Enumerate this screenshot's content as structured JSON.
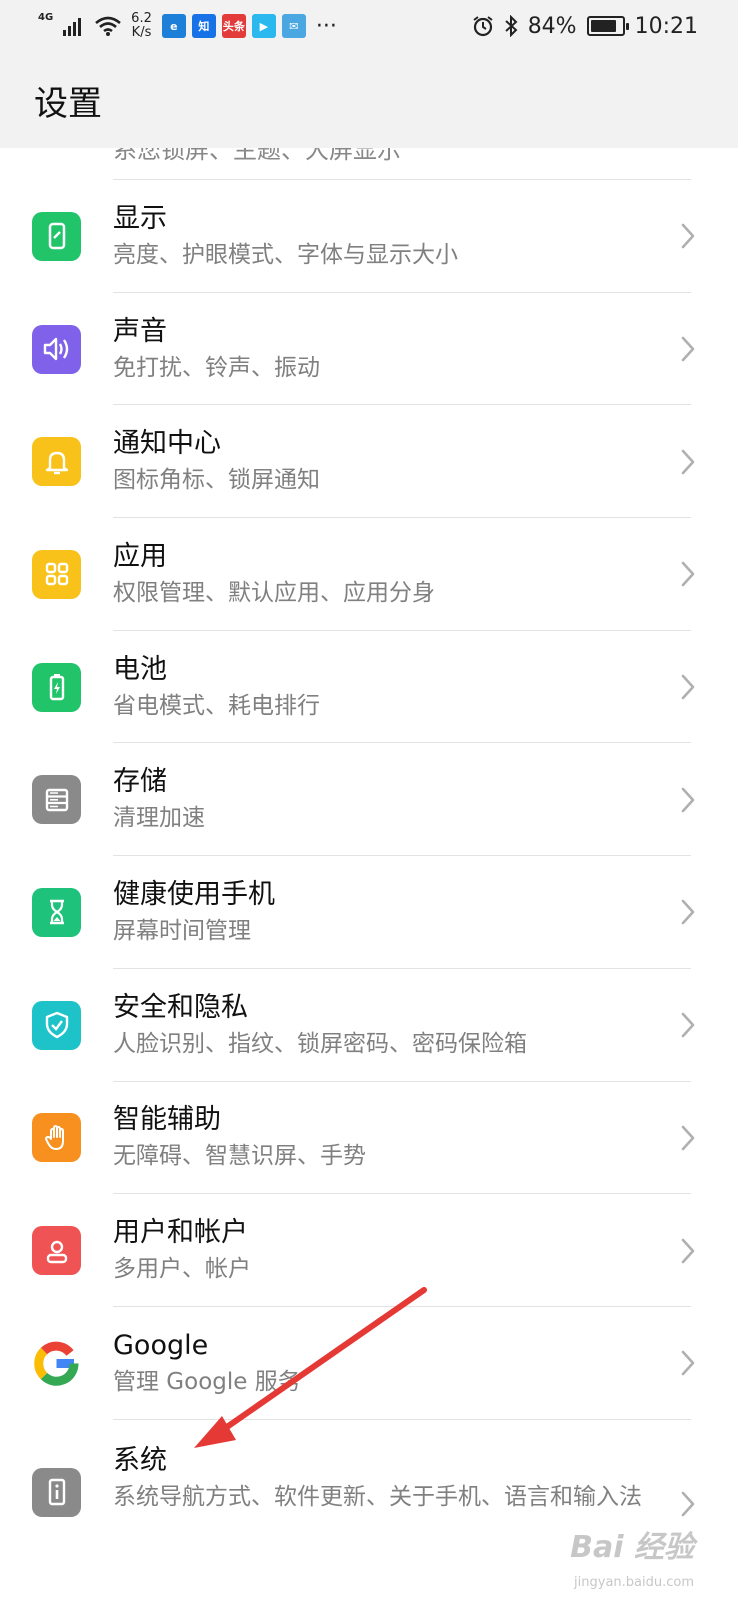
{
  "status_bar": {
    "network": "4G",
    "speed_value": "6.2",
    "speed_unit": "K/s",
    "notification_apps": [
      {
        "icon": "browser-icon",
        "label": "e",
        "color": "#1e7fd8"
      },
      {
        "icon": "zhihu-icon",
        "label": "知",
        "color": "#1772e8"
      },
      {
        "icon": "toutiao-icon",
        "label": "头条",
        "color": "#e33a3a"
      },
      {
        "icon": "video-icon",
        "label": "▶",
        "color": "#2bb8ef"
      },
      {
        "icon": "mail-icon",
        "label": "✉",
        "color": "#4aa7e2"
      }
    ],
    "more": "···",
    "battery_percent": "84%",
    "battery_level": 0.84,
    "time": "10:21"
  },
  "header": {
    "title": "设置"
  },
  "cut_row": {
    "text": "系您锁屏、主题、大屏显示"
  },
  "items": [
    {
      "name": "display",
      "icon": "display-icon",
      "color": "#22c46a",
      "title": "显示",
      "subtitle": "亮度、护眼模式、字体与显示大小"
    },
    {
      "name": "sound",
      "icon": "speaker-icon",
      "color": "#8062ea",
      "title": "声音",
      "subtitle": "免打扰、铃声、振动"
    },
    {
      "name": "notification",
      "icon": "bell-icon",
      "color": "#f8c21b",
      "title": "通知中心",
      "subtitle": "图标角标、锁屏通知"
    },
    {
      "name": "apps",
      "icon": "grid-icon",
      "color": "#f8c21b",
      "title": "应用",
      "subtitle": "权限管理、默认应用、应用分身"
    },
    {
      "name": "battery",
      "icon": "battery-icon",
      "color": "#22c46a",
      "title": "电池",
      "subtitle": "省电模式、耗电排行"
    },
    {
      "name": "storage",
      "icon": "storage-icon",
      "color": "#8a8a8a",
      "title": "存储",
      "subtitle": "清理加速"
    },
    {
      "name": "digital-balance",
      "icon": "hourglass-icon",
      "color": "#1fc27a",
      "title": "健康使用手机",
      "subtitle": "屏幕时间管理"
    },
    {
      "name": "security",
      "icon": "shield-icon",
      "color": "#1ec3c9",
      "title": "安全和隐私",
      "subtitle": "人脸识别、指纹、锁屏密码、密码保险箱"
    },
    {
      "name": "accessibility",
      "icon": "hand-icon",
      "color": "#f7901e",
      "title": "智能辅助",
      "subtitle": "无障碍、智慧识屏、手势"
    },
    {
      "name": "accounts",
      "icon": "user-icon",
      "color": "#ef5353",
      "title": "用户和帐户",
      "subtitle": "多用户、帐户"
    },
    {
      "name": "google",
      "icon": "google-icon",
      "color": "#ffffff",
      "title": "Google",
      "subtitle": "管理 Google 服务"
    },
    {
      "name": "system",
      "icon": "info-icon",
      "color": "#8a8a8a",
      "title": "系统",
      "subtitle": "系统导航方式、软件更新、关于手机、语言和输入法"
    }
  ],
  "watermark": {
    "text": "Bai 经验",
    "sub": "jingyan.baidu.com"
  },
  "colors": {
    "arrow": "#e53935",
    "header_bg": "#f2f2f2"
  }
}
